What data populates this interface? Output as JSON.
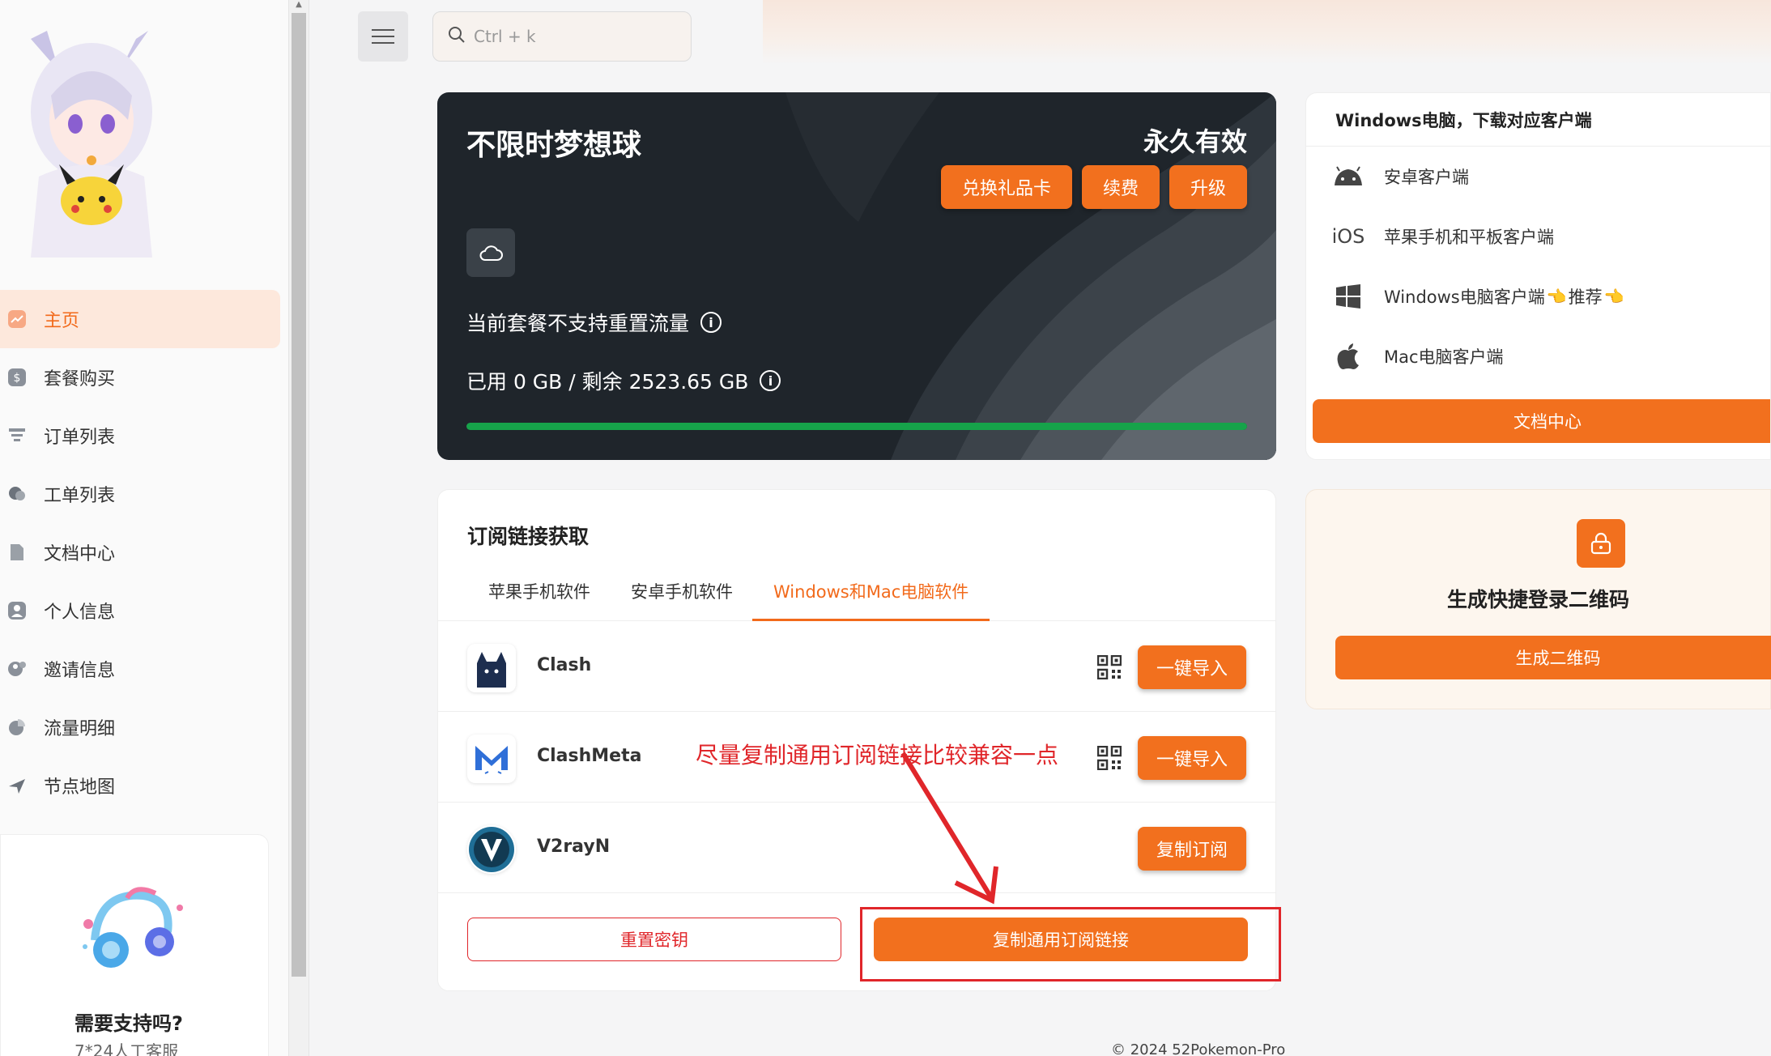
{
  "sidebar": {
    "items": [
      {
        "label": "主页",
        "icon": "home-chart-icon"
      },
      {
        "label": "套餐购买",
        "icon": "dollar-icon"
      },
      {
        "label": "订单列表",
        "icon": "list-icon"
      },
      {
        "label": "工单列表",
        "icon": "chat-icon"
      },
      {
        "label": "文档中心",
        "icon": "document-icon"
      },
      {
        "label": "个人信息",
        "icon": "user-icon"
      },
      {
        "label": "邀请信息",
        "icon": "invite-icon"
      },
      {
        "label": "流量明细",
        "icon": "pie-icon"
      },
      {
        "label": "节点地图",
        "icon": "plane-icon"
      }
    ],
    "support": {
      "title": "需要支持吗?",
      "subtitle": "7*24人工客服"
    }
  },
  "header": {
    "search_placeholder": "Ctrl + k"
  },
  "plan": {
    "title": "不限时梦想球",
    "validity": "永久有效",
    "buttons": {
      "redeem": "兑换礼品卡",
      "renew": "续费",
      "upgrade": "升级"
    },
    "reset_note": "当前套餐不支持重置流量",
    "usage": "已用 0 GB / 剩余 2523.65 GB",
    "used_fraction": 0.0
  },
  "subscription": {
    "title": "订阅链接获取",
    "tabs": [
      "苹果手机软件",
      "安卓手机软件",
      "Windows和Mac电脑软件"
    ],
    "active_tab": 2,
    "rows": [
      {
        "name": "Clash",
        "action": "一键导入"
      },
      {
        "name": "ClashMeta",
        "action": "一键导入"
      },
      {
        "name": "V2rayN",
        "action": "复制订阅"
      }
    ],
    "annotation": "尽量复制通用订阅链接比较兼容一点",
    "reset_key": "重置密钥",
    "copy_all": "复制通用订阅链接"
  },
  "clients": {
    "title": "Windows电脑，下载对应客户端",
    "items": [
      {
        "label": "安卓客户端",
        "icon": "android-icon"
      },
      {
        "label": "苹果手机和平板客户端",
        "icon_text": "iOS"
      },
      {
        "label": "Windows电脑客户端",
        "recommend": "推荐",
        "icon": "windows-icon"
      },
      {
        "label": "Mac电脑客户端",
        "icon": "apple-icon"
      }
    ],
    "doc_button": "文档中心"
  },
  "qrcard": {
    "title": "生成快捷登录二维码",
    "button": "生成二维码"
  },
  "footer": {
    "text": "© 2024 52Pokemon-Pro"
  },
  "colors": {
    "accent": "#f2701e",
    "active_bg": "#fde8dc",
    "progress": "#16a34a",
    "annotation": "#e0262a"
  }
}
